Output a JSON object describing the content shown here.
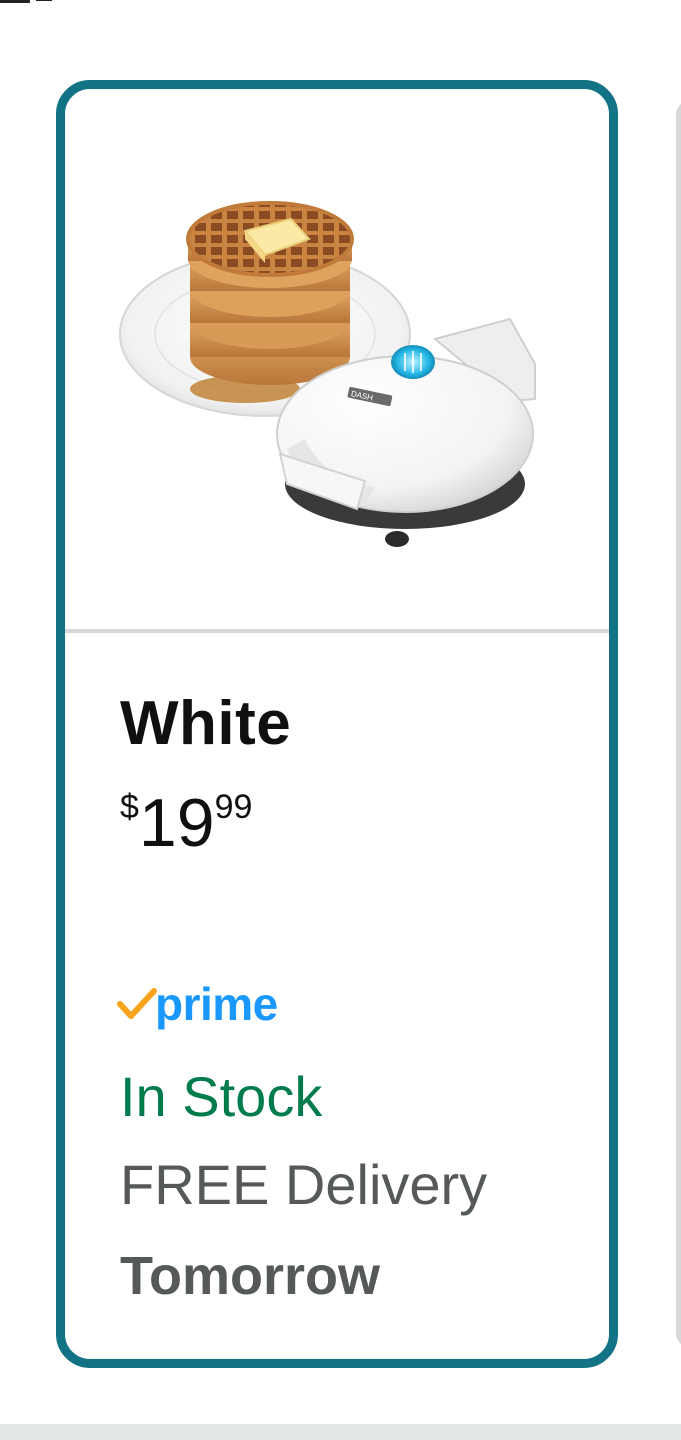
{
  "card": {
    "color_name": "White",
    "price": {
      "currency_symbol": "$",
      "whole": "19",
      "fraction": "99"
    },
    "prime": {
      "check_icon": "checkmark-icon",
      "label": "prime"
    },
    "stock_status": "In Stock",
    "delivery": "FREE Delivery",
    "delivery_date": "Tomorrow",
    "image_label": "DASH"
  },
  "colors": {
    "selected_border": "#127385",
    "in_stock": "#007b4c",
    "prime_blue": "#1a98ff",
    "prime_check": "#f7a31c",
    "secondary_text": "#565959",
    "primary_text": "#0f1111"
  }
}
